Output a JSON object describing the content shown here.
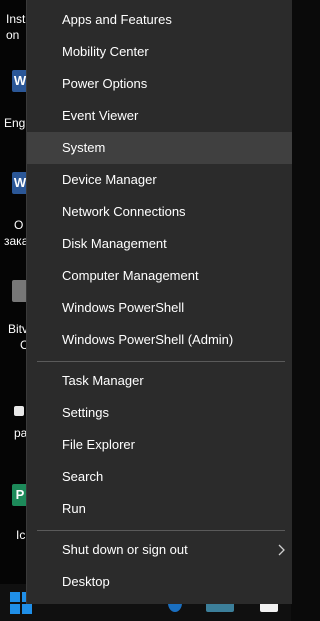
{
  "desktop": {
    "labels": [
      "Inst",
      "on",
      "Eng",
      "O",
      "зака",
      "Bitv",
      "C",
      "ра",
      "Ic"
    ]
  },
  "menu": {
    "group1": [
      "Apps and Features",
      "Mobility Center",
      "Power Options",
      "Event Viewer",
      "System",
      "Device Manager",
      "Network Connections",
      "Disk Management",
      "Computer Management",
      "Windows PowerShell",
      "Windows PowerShell (Admin)"
    ],
    "group2": [
      "Task Manager",
      "Settings",
      "File Explorer",
      "Search",
      "Run"
    ],
    "group3": [
      "Shut down or sign out",
      "Desktop"
    ],
    "highlighted_item": "System"
  },
  "colors": {
    "menu_bg": "#2b2b2b",
    "hover_bg": "#404040",
    "separator": "#5a5a5a",
    "text": "#ffffff",
    "start_blue": "#1f8fe8"
  },
  "icons": {
    "submenu": "chevron-right-icon",
    "start": "windows-logo-icon"
  }
}
